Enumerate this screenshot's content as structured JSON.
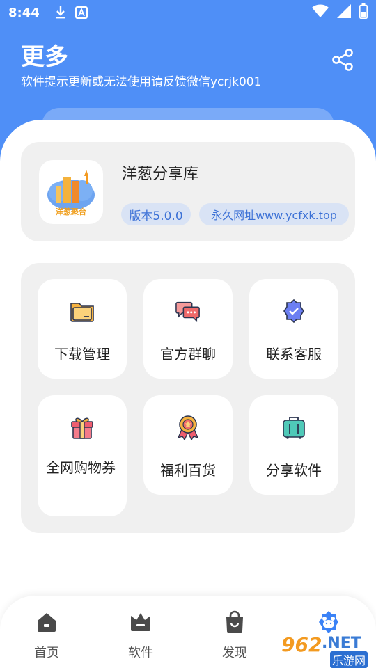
{
  "status_bar": {
    "time": "8:44"
  },
  "header": {
    "title": "更多",
    "subtitle": "软件提示更新或无法使用请反馈微信ycrjk001"
  },
  "app_card": {
    "logo_text": "洋葱聚合",
    "name": "洋葱分享库",
    "version": "版本5.0.0",
    "site": "永久网址www.ycfxk.top"
  },
  "tiles": [
    {
      "label": "下载管理",
      "icon": "folder-icon"
    },
    {
      "label": "官方群聊",
      "icon": "chat-bubbles-icon"
    },
    {
      "label": "联系客服",
      "icon": "verified-badge-icon"
    },
    {
      "label": "全网购物券",
      "icon": "gift-icon"
    },
    {
      "label": "福利百货",
      "icon": "medal-icon"
    },
    {
      "label": "分享软件",
      "icon": "luggage-icon"
    }
  ],
  "bottom_nav": [
    {
      "label": "首页",
      "icon": "home-icon"
    },
    {
      "label": "软件",
      "icon": "crown-icon"
    },
    {
      "label": "发现",
      "icon": "bag-icon"
    },
    {
      "label": "",
      "icon": "bear-icon"
    }
  ],
  "watermark": {
    "number": "962",
    "suffix": ".NET",
    "sub": "乐游网"
  },
  "colors": {
    "primary": "#4f8ff7",
    "chip_bg": "#d9e3f5",
    "chip_text": "#3c71d6",
    "panel_bg": "#f0f0f0"
  }
}
